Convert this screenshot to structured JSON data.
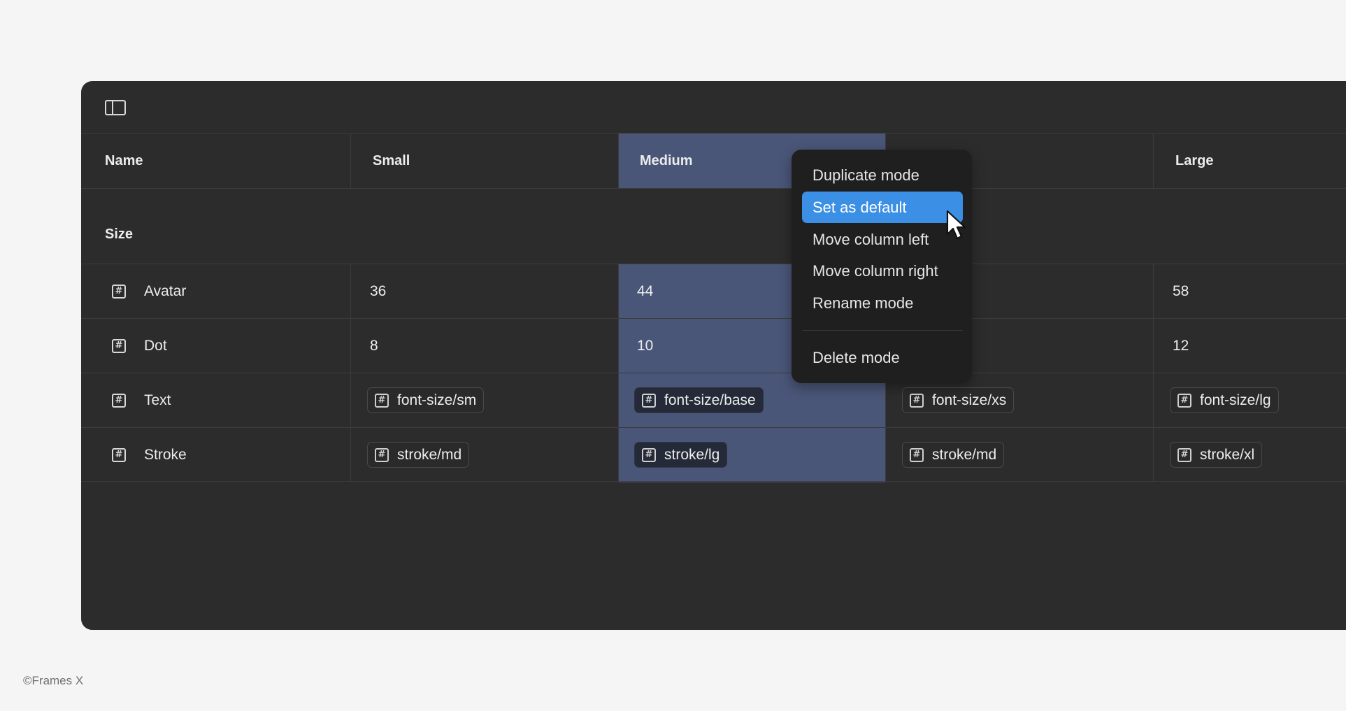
{
  "header": {
    "columns": [
      "Name",
      "Small",
      "Medium",
      "",
      "Large"
    ]
  },
  "group": {
    "label": "Size"
  },
  "rows": [
    {
      "name": "Avatar",
      "small": "36",
      "medium": "44",
      "fourth": "",
      "large": "58"
    },
    {
      "name": "Dot",
      "small": "8",
      "medium": "10",
      "fourth": "",
      "large": "12"
    },
    {
      "name": "Text",
      "small": "font-size/sm",
      "medium": "font-size/base",
      "fourth": "font-size/xs",
      "large": "font-size/lg"
    },
    {
      "name": "Stroke",
      "small": "stroke/md",
      "medium": "stroke/lg",
      "fourth": "stroke/md",
      "large": "stroke/xl"
    }
  ],
  "context_menu": {
    "items": [
      "Duplicate mode",
      "Set as default",
      "Move column left",
      "Move column right",
      "Rename mode",
      "Delete mode"
    ],
    "highlighted": "Set as default"
  },
  "icons": {
    "toolbar": "sidebar-toggle-icon",
    "variable": "hash-icon",
    "pointer": "mouse-cursor-icon"
  },
  "colors": {
    "background": "#f5f5f5",
    "panel": "#2c2c2c",
    "selected_column": "#4a5678",
    "menu": "#1f1f1f",
    "menu_highlight": "#3b8fe4"
  },
  "footer": {
    "credit": "©Frames X"
  }
}
